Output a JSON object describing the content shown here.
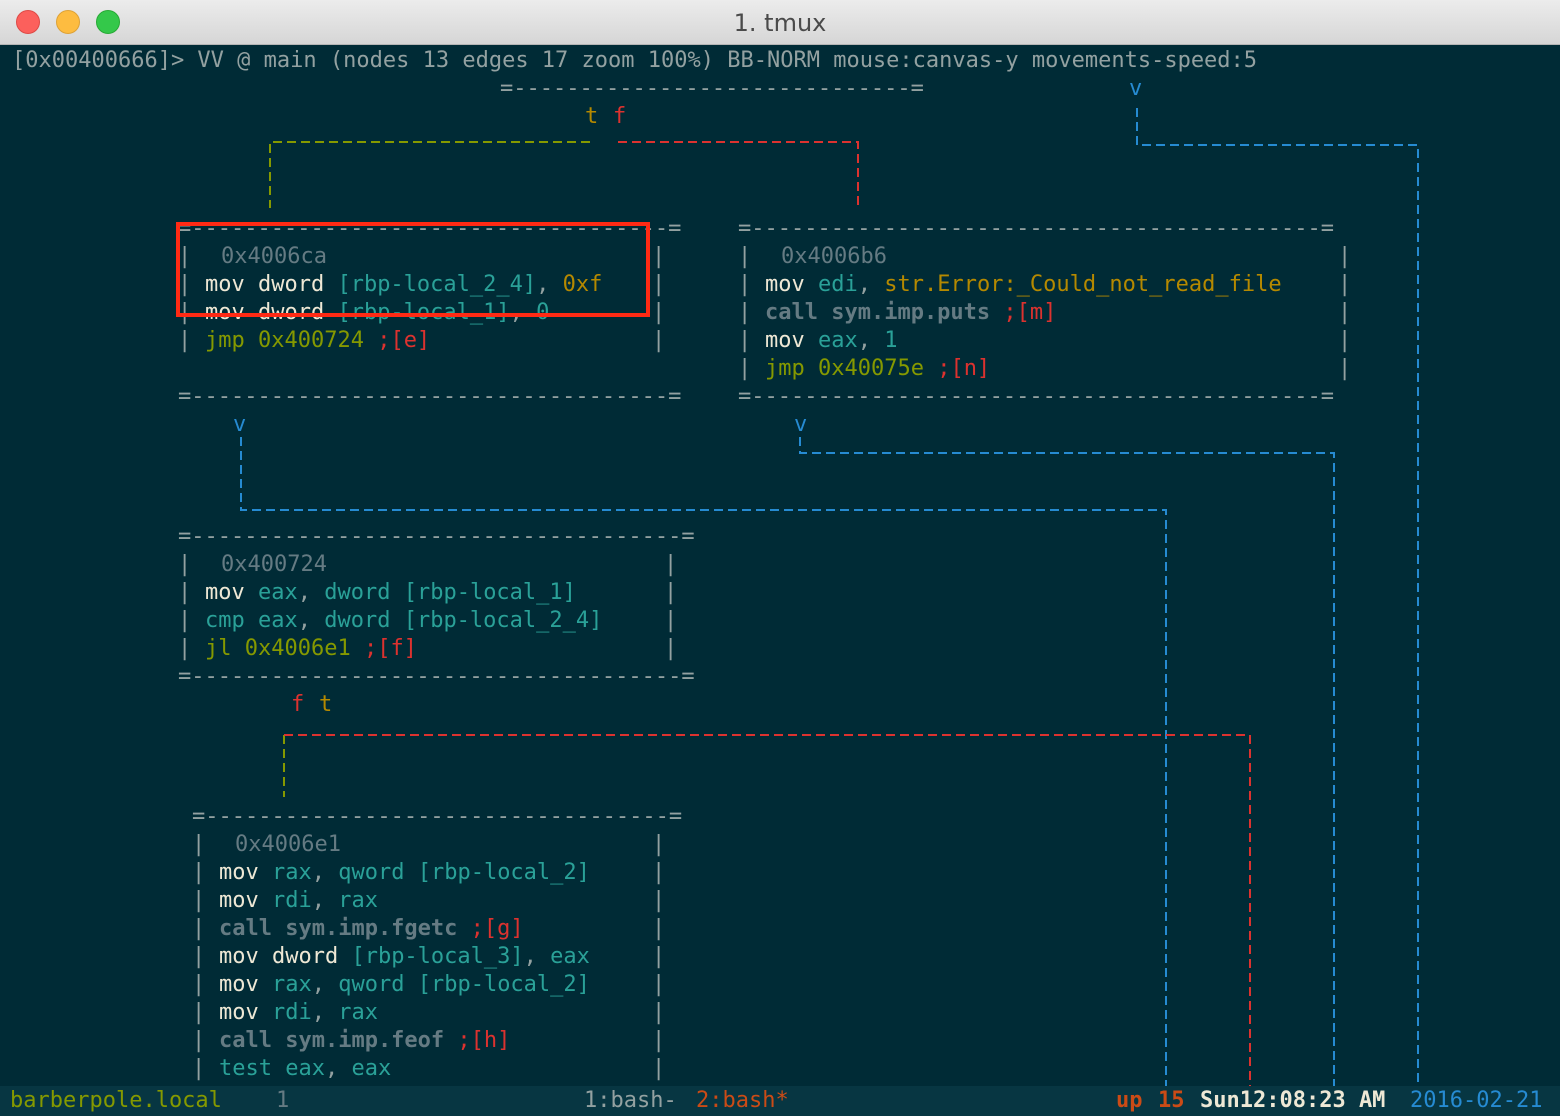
{
  "window": {
    "title": "1. tmux",
    "buttons": [
      {
        "name": "close",
        "color": "#fc605c",
        "border": "#de4a46"
      },
      {
        "name": "minimize",
        "color": "#fdbc40",
        "border": "#dea236"
      },
      {
        "name": "zoom",
        "color": "#34c84a",
        "border": "#27aa35"
      }
    ]
  },
  "palette": {
    "background": "#002b36",
    "statusbar": "#073642",
    "base": "#93a1a1",
    "bright": "#eee8d5",
    "dim": "#657b83",
    "cyan": "#2aa198",
    "yellow": "#b58900",
    "olive": "#859900",
    "red": "#dc322f",
    "blue": "#268bd2",
    "orange": "#cb4b16",
    "highlight": "#ff2a14"
  },
  "prompt": "[0x00400666]> VV @ main (nodes 13 edges 17 zoom 100%) BB-NORM mouse:canvas-y movements-speed:5",
  "graph": {
    "node_frames": {
      "top": "=------------------------------=",
      "a_rule": "=------------------------------------=",
      "b_rule": "=-------------------------------------------=",
      "c_rule": "=-------------------------------------=",
      "d_top": "=-----------------------------------=",
      "d_bottom": "=-----------------------------------=",
      "bar": "|"
    },
    "edge_labels": {
      "top_t": "t",
      "top_f": "f",
      "mid_f": "f",
      "mid_t": "t",
      "arrow": "v"
    },
    "nodes": [
      {
        "address": "0x4006ca",
        "lines": [
          [
            {
              "t": "mov dword ",
              "c": "bright"
            },
            {
              "t": "[rbp-local_2_4]",
              "c": "cyan"
            },
            {
              "t": ", ",
              "c": "base"
            },
            {
              "t": "0xf",
              "c": "yellow"
            }
          ],
          [
            {
              "t": "mov dword ",
              "c": "bright"
            },
            {
              "t": "[rbp-local_1]",
              "c": "cyan"
            },
            {
              "t": ", ",
              "c": "base"
            },
            {
              "t": "0",
              "c": "cyan"
            }
          ],
          [
            {
              "t": "jmp 0x400724",
              "c": "olive"
            },
            {
              "t": " ;[e]",
              "c": "red"
            }
          ]
        ]
      },
      {
        "address": "0x4006b6",
        "lines": [
          [
            {
              "t": "mov ",
              "c": "bright"
            },
            {
              "t": "edi",
              "c": "cyan"
            },
            {
              "t": ", ",
              "c": "base"
            },
            {
              "t": "str.Error:_Could_not_read_file",
              "c": "yellow"
            }
          ],
          [
            {
              "t": "call sym.imp.puts",
              "c": "dim",
              "b": true
            },
            {
              "t": " ;[m]",
              "c": "red"
            }
          ],
          [
            {
              "t": "mov ",
              "c": "bright"
            },
            {
              "t": "eax",
              "c": "cyan"
            },
            {
              "t": ", ",
              "c": "base"
            },
            {
              "t": "1",
              "c": "cyan"
            }
          ],
          [
            {
              "t": "jmp 0x40075e",
              "c": "olive"
            },
            {
              "t": " ;[n]",
              "c": "red"
            }
          ]
        ]
      },
      {
        "address": "0x400724",
        "lines": [
          [
            {
              "t": "mov ",
              "c": "bright"
            },
            {
              "t": "eax",
              "c": "cyan"
            },
            {
              "t": ", ",
              "c": "base"
            },
            {
              "t": "dword ",
              "c": "cyan"
            },
            {
              "t": "[rbp-local_1]",
              "c": "cyan"
            }
          ],
          [
            {
              "t": "cmp eax",
              "c": "cyan"
            },
            {
              "t": ", ",
              "c": "base"
            },
            {
              "t": "dword ",
              "c": "cyan"
            },
            {
              "t": "[rbp-local_2_4]",
              "c": "cyan"
            }
          ],
          [
            {
              "t": "jl 0x4006e1",
              "c": "olive"
            },
            {
              "t": " ;[f]",
              "c": "red"
            }
          ]
        ]
      },
      {
        "address": "0x4006e1",
        "lines": [
          [
            {
              "t": "mov ",
              "c": "bright"
            },
            {
              "t": "rax",
              "c": "cyan"
            },
            {
              "t": ", ",
              "c": "base"
            },
            {
              "t": "qword ",
              "c": "cyan"
            },
            {
              "t": "[rbp-local_2]",
              "c": "cyan"
            }
          ],
          [
            {
              "t": "mov ",
              "c": "bright"
            },
            {
              "t": "rdi",
              "c": "cyan"
            },
            {
              "t": ", ",
              "c": "base"
            },
            {
              "t": "rax",
              "c": "cyan"
            }
          ],
          [
            {
              "t": "call sym.imp.fgetc",
              "c": "dim",
              "b": true
            },
            {
              "t": " ;[g]",
              "c": "red"
            }
          ],
          [
            {
              "t": "mov dword ",
              "c": "bright"
            },
            {
              "t": "[rbp-local_3]",
              "c": "cyan"
            },
            {
              "t": ", ",
              "c": "base"
            },
            {
              "t": "eax",
              "c": "cyan"
            }
          ],
          [
            {
              "t": "mov ",
              "c": "bright"
            },
            {
              "t": "rax",
              "c": "cyan"
            },
            {
              "t": ", ",
              "c": "base"
            },
            {
              "t": "qword ",
              "c": "cyan"
            },
            {
              "t": "[rbp-local_2]",
              "c": "cyan"
            }
          ],
          [
            {
              "t": "mov ",
              "c": "bright"
            },
            {
              "t": "rdi",
              "c": "cyan"
            },
            {
              "t": ", ",
              "c": "base"
            },
            {
              "t": "rax",
              "c": "cyan"
            }
          ],
          [
            {
              "t": "call sym.imp.feof",
              "c": "dim",
              "b": true
            },
            {
              "t": " ;[h]",
              "c": "red"
            }
          ],
          [
            {
              "t": "test eax",
              "c": "cyan"
            },
            {
              "t": ", ",
              "c": "base"
            },
            {
              "t": "eax",
              "c": "cyan"
            }
          ]
        ]
      }
    ]
  },
  "statusbar": {
    "host": "barberpole.local",
    "session": "1",
    "windows": [
      {
        "label": "1:bash-",
        "active": false
      },
      {
        "label": "2:bash*",
        "active": true
      }
    ],
    "uptime_label": "up",
    "uptime_value": "15",
    "datetime": "Sun12:08:23 AM",
    "date": "2016-02-21"
  }
}
